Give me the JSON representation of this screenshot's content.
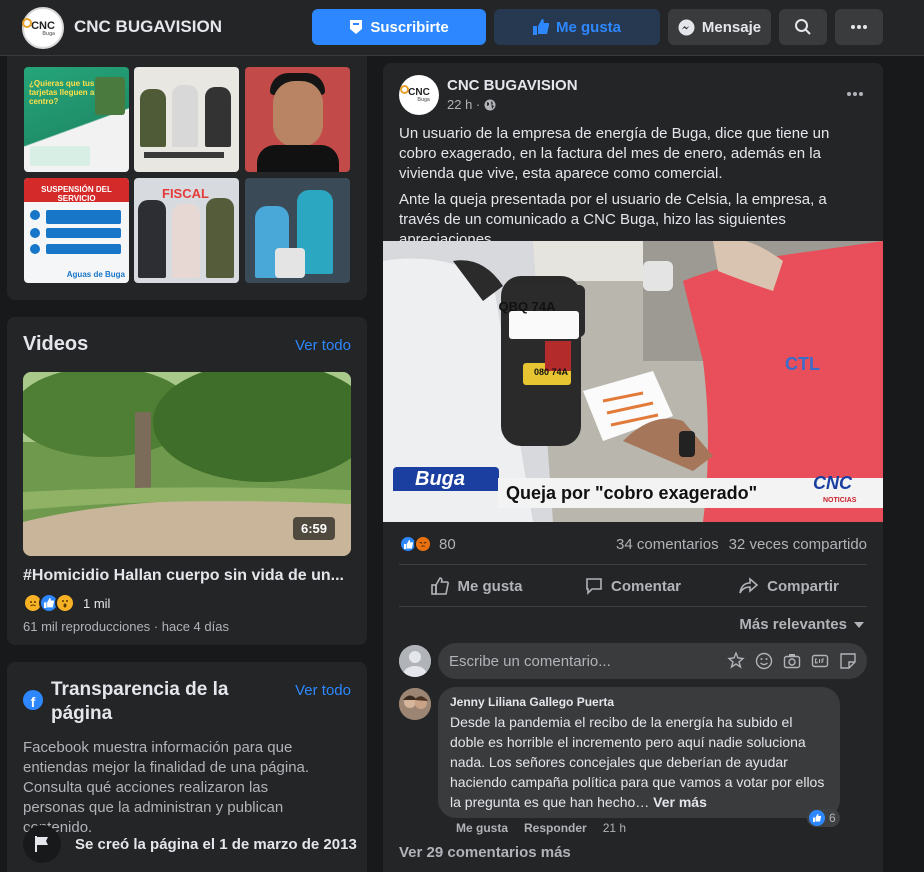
{
  "header": {
    "page_name": "CNC BUGAVISION",
    "subscribe_label": "Suscribirte",
    "like_label": "Me gusta",
    "message_label": "Mensaje"
  },
  "logo": {
    "text": "CNC",
    "sub": "Buga"
  },
  "photos": {
    "tile1_text": "¿Quieras que tus tarjetas lleguen al centro?",
    "tile4_text": "SUSPENSIÓN DEL SERVICIO",
    "tile4_brand": "Aguas de Buga",
    "tile5_banner": "FISCAL"
  },
  "videos": {
    "title": "Videos",
    "see_all": "Ver todo",
    "duration": "6:59",
    "video_title": "#Homicidio Hallan cuerpo sin vida de un...",
    "reaction_count": "1 mil",
    "meta": "61 mil reproducciones · hace 4 días"
  },
  "transparency": {
    "title": "Transparencia de la página",
    "see_all": "Ver todo",
    "description": "Facebook muestra información para que entiendas mejor la finalidad de una página. Consulta qué acciones realizaron las personas que la administran y publican contenido.",
    "created": "Se creó la página el 1 de marzo de 2013"
  },
  "post": {
    "author": "CNC BUGAVISION",
    "time": "22 h ·",
    "paragraph1": "Un usuario de la empresa de energía de Buga, dice que tiene un cobro exagerado, en la factura del mes de enero, además en la vivienda que vive, esta aparece como comercial.",
    "paragraph2": "Ante la queja presentada por el usuario de Celsia, la empresa, a través de un comunicado a CNC Buga, hizo las siguientes apreciaciones.",
    "image": {
      "plate_top": "QBQ 74A",
      "plate_bottom": "080 74A",
      "shirt_logo": "CTL",
      "location_tag": "Buga",
      "headline": "Queja por \"cobro exagerado\"",
      "watermark": "CNC",
      "watermark_sub": "NOTICIAS"
    },
    "reactions_count": "80",
    "comments_count": "34 comentarios",
    "shares_count": "32 veces compartido",
    "actions": {
      "like": "Me gusta",
      "comment": "Comentar",
      "share": "Compartir"
    },
    "sort_label": "Más relevantes",
    "comment_placeholder": "Escribe un comentario...",
    "comment": {
      "author": "Jenny Liliana Gallego Puerta",
      "text": "Desde la pandemia el recibo de la energía ha subido el doble es horrible el incremento pero aquí nadie soluciona nada. Los señores concejales que deberían de ayudar haciendo campaña política para que vamos a votar por ellos la pregunta es que han hecho…",
      "see_more": "Ver más",
      "like_action": "Me gusta",
      "reply_action": "Responder",
      "time": "21 h",
      "reaction_count": "6"
    },
    "view_more_comments": "Ver 29 comentarios más"
  },
  "colors": {
    "background": "#18191a",
    "surface": "#242526",
    "accent": "#2d88ff",
    "secondary_text": "#b0b3b8"
  }
}
